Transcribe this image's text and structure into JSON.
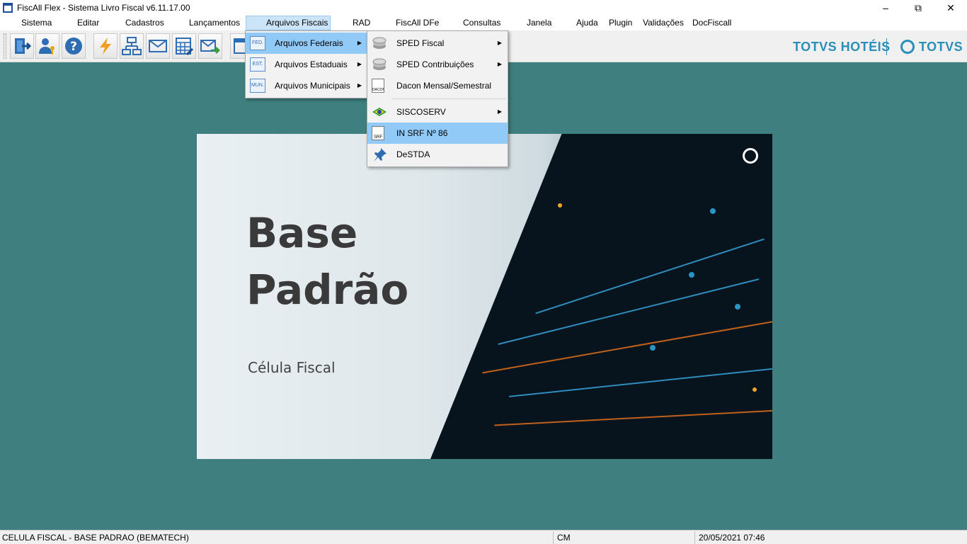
{
  "window": {
    "title": "FiscAll Flex - Sistema Livro Fiscal v6.11.17.00",
    "minimize_icon": "minimize-icon",
    "restore_icon": "restore-icon",
    "close_icon": "close-icon"
  },
  "menubar": {
    "items": [
      {
        "label": "Sistema"
      },
      {
        "label": "Editar"
      },
      {
        "label": "Cadastros"
      },
      {
        "label": "Lançamentos"
      },
      {
        "label": "Arquivos Fiscais"
      },
      {
        "label": "RAD"
      },
      {
        "label": "FiscAll DFe"
      },
      {
        "label": "Consultas"
      },
      {
        "label": "Janela"
      },
      {
        "label": "Ajuda"
      },
      {
        "label": "Plugin"
      },
      {
        "label": "Validações"
      },
      {
        "label": "DocFiscall"
      }
    ]
  },
  "toolbar": {
    "buttons": [
      {
        "icon": "exit-door-icon"
      },
      {
        "icon": "user-key-icon"
      },
      {
        "icon": "help-icon"
      },
      {
        "icon": "lightning-icon"
      },
      {
        "icon": "network-icon"
      },
      {
        "icon": "mail-icon"
      },
      {
        "icon": "calculator-icon"
      },
      {
        "icon": "send-mail-icon"
      },
      {
        "icon": "window-icon"
      }
    ]
  },
  "brand": {
    "left": "TOTVS HOTÉIS",
    "right": "TOTVS"
  },
  "splash": {
    "title_line1": "Base",
    "title_line2": "Padrão",
    "subtitle": "Célula Fiscal"
  },
  "menu_arquivos": {
    "items": [
      {
        "label": "Arquivos Federais",
        "icon": "fed-icon",
        "icon_text": "FED."
      },
      {
        "label": "Arquivos Estaduais",
        "icon": "est-icon",
        "icon_text": "EST."
      },
      {
        "label": "Arquivos Municipais",
        "icon": "mun-icon",
        "icon_text": "MUN."
      }
    ]
  },
  "menu_federais": {
    "items": [
      {
        "label": "SPED Fiscal",
        "icon": "sped-disk-icon"
      },
      {
        "label": "SPED Contribuições",
        "icon": "sped-disk-icon"
      },
      {
        "label": "Dacon Mensal/Semestral",
        "icon": "dacon-document-icon",
        "icon_text": "DACON"
      },
      {
        "label": "SISCOSERV",
        "icon": "brazil-flag-icon"
      },
      {
        "label": "IN SRF Nº 86",
        "icon": "srf-document-icon",
        "icon_text": "SRF"
      },
      {
        "label": "DeSTDA",
        "icon": "pushpin-icon"
      }
    ]
  },
  "statusbar": {
    "company": "CELULA FISCAL - BASE PADRAO (BEMATECH)",
    "code": "CM",
    "datetime": "20/05/2021 07:46"
  },
  "colors": {
    "workspace": "#3f7f7f",
    "highlight": "#91c9f7",
    "brand": "#2a8fb8"
  }
}
